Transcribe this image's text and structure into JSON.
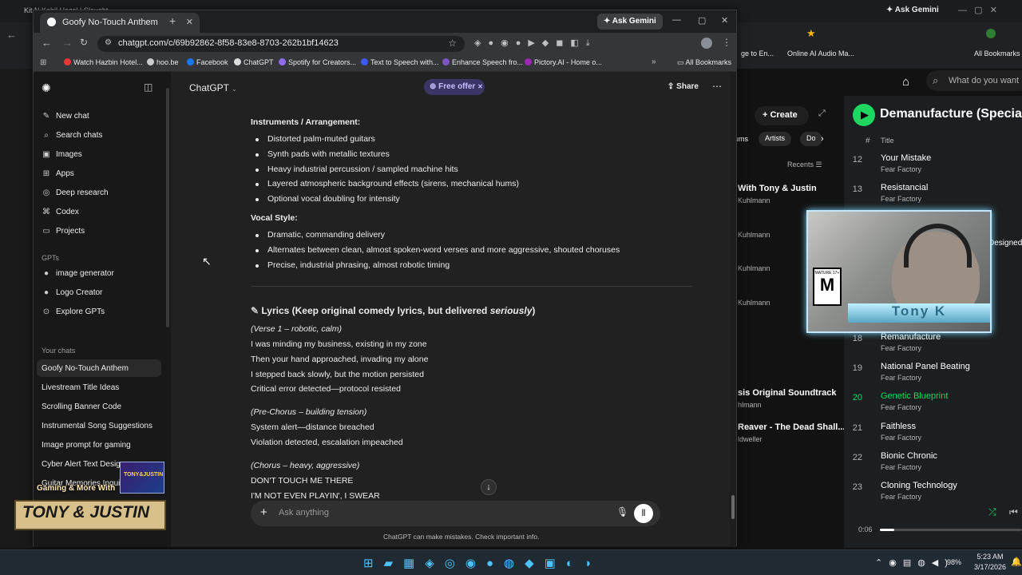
{
  "bg_browser": {
    "tab_title": "Kit N Kabil Hazel | Slaught...",
    "gemini": "Ask Gemini",
    "bookmarks": [
      "ge to En...",
      "Online AI Audio Ma..."
    ],
    "all_bookmarks": "All Bookmarks"
  },
  "chrome": {
    "tab_title": "Goofy No-Touch Anthem",
    "gemini": "Ask Gemini",
    "url": "chatgpt.com/c/69b92862-8f58-83e8-8703-262b1bf14623",
    "bookmarks": [
      {
        "label": "Watch Hazbin Hotel...",
        "color": "#e53935"
      },
      {
        "label": "hoo.be",
        "color": "#cccccc"
      },
      {
        "label": "Facebook",
        "color": "#1877f2"
      },
      {
        "label": "ChatGPT",
        "color": "#dddddd"
      },
      {
        "label": "Spotify for Creators...",
        "color": "#8d6cf0"
      },
      {
        "label": "Text to Speech with...",
        "color": "#3d5afe"
      },
      {
        "label": "Enhance Speech fro...",
        "color": "#7e57c2"
      },
      {
        "label": "Pictory.AI - Home o...",
        "color": "#9c27b0"
      }
    ],
    "all_bookmarks": "All Bookmarks"
  },
  "sidebar": {
    "items": [
      {
        "label": "New chat",
        "icon": "✎"
      },
      {
        "label": "Search chats",
        "icon": "⌕"
      },
      {
        "label": "Images",
        "icon": "▣"
      },
      {
        "label": "Apps",
        "icon": "⊞"
      },
      {
        "label": "Deep research",
        "icon": "◎"
      },
      {
        "label": "Codex",
        "icon": "⌘"
      },
      {
        "label": "Projects",
        "icon": "▭"
      }
    ],
    "gpts_header": "GPTs",
    "gpts": [
      {
        "label": "image generator",
        "icon": "●"
      },
      {
        "label": "Logo Creator",
        "icon": "●"
      },
      {
        "label": "Explore GPTs",
        "icon": "⊙"
      }
    ],
    "chats_header": "Your chats",
    "chats": [
      "Goofy No-Touch Anthem",
      "Livestream Title Ideas",
      "Scrolling Banner Code",
      "Instrumental Song Suggestions",
      "Image prompt for gaming",
      "Cyber Alert Text Design",
      "Guitar Memories Inquiry"
    ]
  },
  "header": {
    "model": "ChatGPT",
    "offer": "Free offer",
    "share": "Share"
  },
  "content": {
    "instruments_heading": "Instruments / Arrangement:",
    "instruments": [
      "Distorted palm-muted guitars",
      "Synth pads with metallic textures",
      "Heavy industrial percussion / sampled machine hits",
      "Layered atmospheric background effects (sirens, mechanical hums)",
      "Optional vocal doubling for intensity"
    ],
    "vocal_heading": "Vocal Style:",
    "vocal": [
      "Dramatic, commanding delivery",
      "Alternates between clean, almost spoken-word verses and more aggressive, shouted choruses",
      "Precise, industrial phrasing, almost robotic timing"
    ],
    "lyrics_heading_a": "Lyrics (Keep original comedy lyrics, but delivered ",
    "lyrics_heading_b": "seriously",
    "lyrics_heading_c": ")",
    "verse1_label": "(Verse 1 – robotic, calm)",
    "verse1": [
      "I was minding my business, existing in my zone",
      "Then your hand approached, invading my alone",
      "I stepped back slowly, but the motion persisted",
      "Critical error detected—protocol resisted"
    ],
    "prechorus_label": "(Pre-Chorus – building tension)",
    "prechorus": [
      "System alert—distance breached",
      "Violation detected, escalation impeached"
    ],
    "chorus_label": "(Chorus – heavy, aggressive)",
    "chorus": [
      "DON'T TOUCH ME THERE",
      "I'M NOT EVEN PLAYIN', I SWEAR"
    ]
  },
  "composer": {
    "placeholder": "Ask anything",
    "disclaimer": "ChatGPT can make mistakes. Check important info."
  },
  "spotify": {
    "search_placeholder": "What do you want",
    "create": "Create",
    "filters": [
      "ums",
      "Artists",
      "Do"
    ],
    "recents": "Recents",
    "library_items": [
      {
        "title": "With Tony & Justin",
        "sub": "Kuhlmann"
      },
      {
        "title": "",
        "sub": "Kuhlmann"
      },
      {
        "title": "",
        "sub": "Kuhlmann"
      },
      {
        "title": "",
        "sub": "Kuhlmann"
      },
      {
        "title": "sis Original Soundtrack",
        "sub": "hlmann"
      },
      {
        "title": "Reaver - The Dead Shall...",
        "sub": "ldweller"
      }
    ],
    "album_title": "Demanufacture (Special",
    "title_header": "Title",
    "tracks": [
      {
        "n": "12",
        "title": "Your Mistake",
        "artist": "Fear Factory"
      },
      {
        "n": "13",
        "title": "Resistancial",
        "artist": "Fear Factory"
      },
      {
        "n": "18",
        "title": "Remanufacture",
        "artist": "Fear Factory"
      },
      {
        "n": "19",
        "title": "National Panel Beating",
        "artist": "Fear Factory"
      },
      {
        "n": "20",
        "title": "Genetic Blueprint",
        "artist": "Fear Factory"
      },
      {
        "n": "21",
        "title": "Faithless",
        "artist": "Fear Factory"
      },
      {
        "n": "22",
        "title": "Bionic Chronic",
        "artist": "Fear Factory"
      },
      {
        "n": "23",
        "title": "Cloning Technology",
        "artist": "Fear Factory"
      }
    ],
    "designed": "Designed",
    "time": "0:06",
    "progress": 0.1,
    "accent": "#1ed760"
  },
  "webcam": {
    "name": "Tony K",
    "rating_top": "MATURE 17+",
    "rating_letter": "M"
  },
  "stream_overlay": {
    "small": "Gaming & More With",
    "large": "TONY & JUSTIN",
    "badge": "TONY&JUSTIN"
  },
  "taskbar": {
    "battery": "98%",
    "time": "5:23 AM",
    "date": "3/17/2026"
  }
}
